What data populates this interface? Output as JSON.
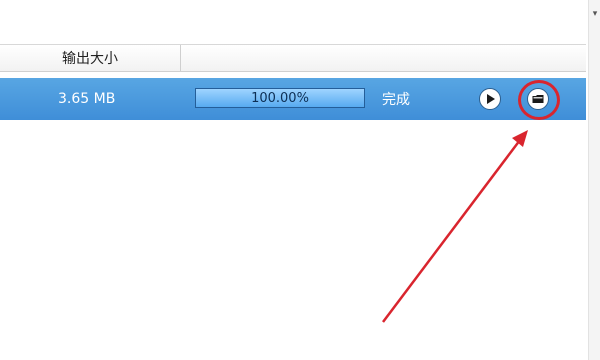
{
  "table": {
    "header": {
      "size_column": "输出大小",
      "rest_column": ""
    },
    "rows": [
      {
        "size": "3.65 MB",
        "progress_label": "100.00%",
        "progress_fraction": 1.0,
        "status": "完成"
      }
    ]
  },
  "icons": {
    "scroll_down": "chevron-down-icon",
    "play": "play-icon",
    "folder": "folder-icon"
  },
  "colors": {
    "selected_row": "#4a9ade",
    "progress_fill": "#7cc2fb",
    "annotation": "#d9252e"
  }
}
